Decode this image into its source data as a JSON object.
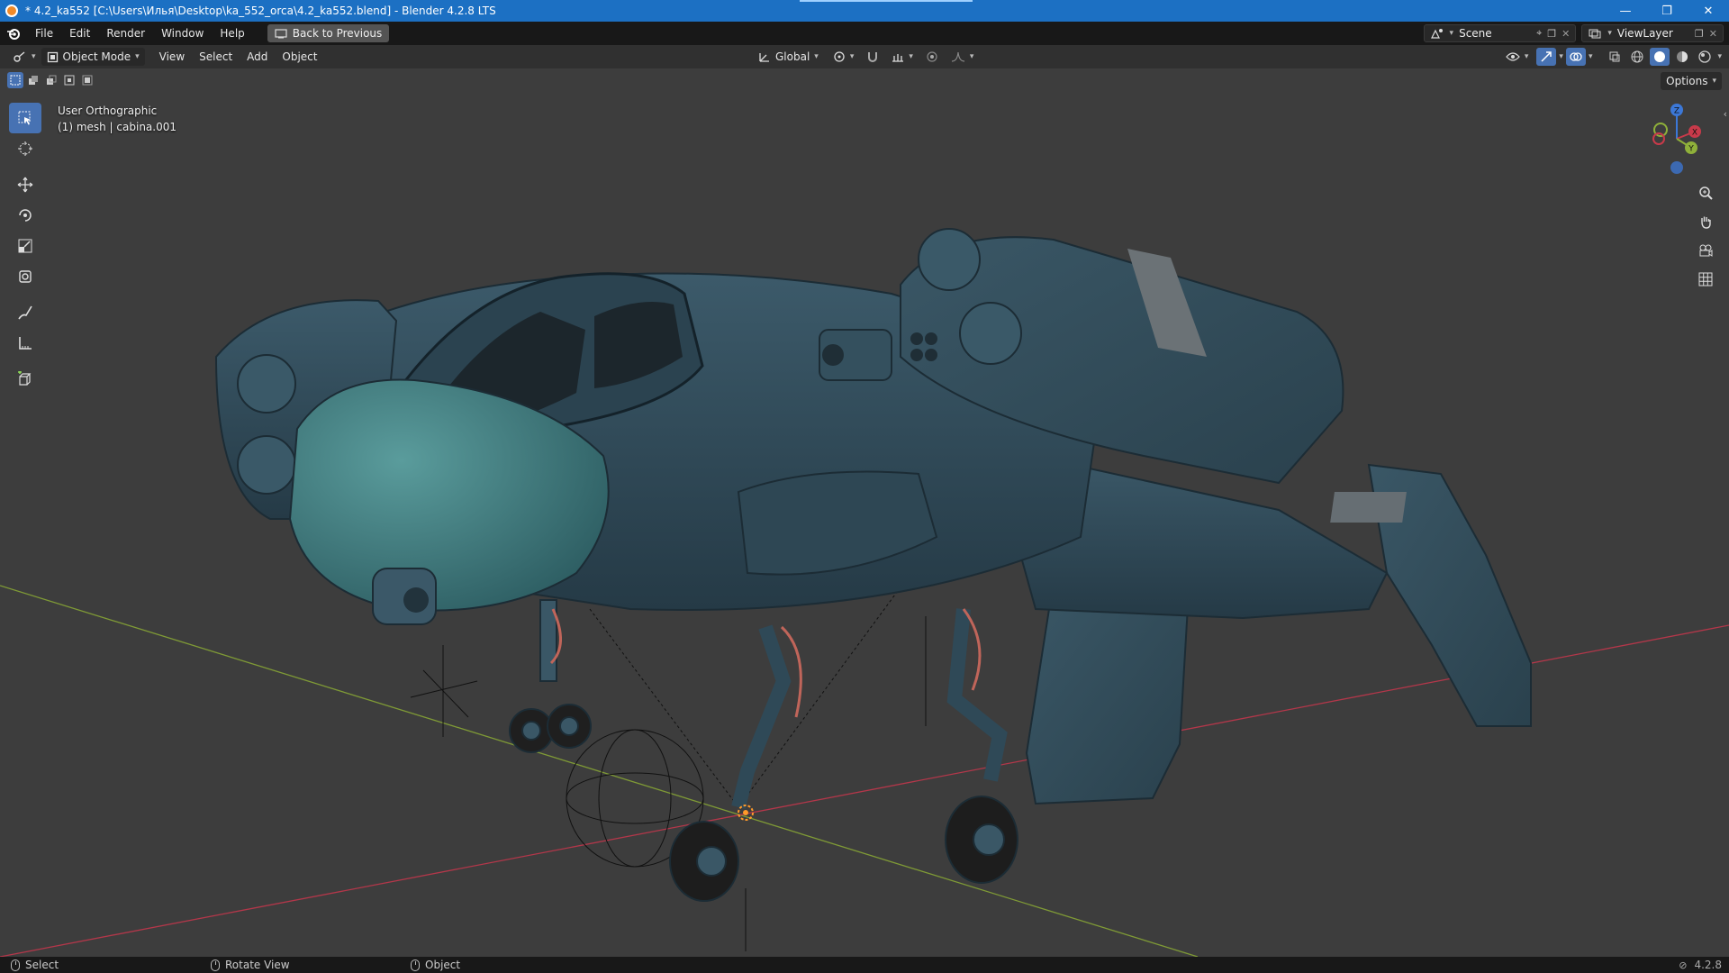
{
  "window": {
    "title": "* 4.2_ka552 [C:\\Users\\Илья\\Desktop\\ka_552_orca\\4.2_ka552.blend] - Blender 4.2.8 LTS",
    "controls": {
      "minimize": "—",
      "restore": "❐",
      "close": "✕"
    }
  },
  "menubar": {
    "items": [
      "File",
      "Edit",
      "Render",
      "Window",
      "Help"
    ],
    "back_button": "Back to Previous",
    "scene": "Scene",
    "view_layer": "ViewLayer"
  },
  "viewheader": {
    "mode": "Object Mode",
    "menus": [
      "View",
      "Select",
      "Add",
      "Object"
    ],
    "transform_orientation": "Global"
  },
  "options_label": "Options",
  "viewport": {
    "view_name": "User Orthographic",
    "object_info": "(1) mesh | cabina.001"
  },
  "gizmo": {
    "z": "Z",
    "x": "X",
    "y": "Y"
  },
  "statusbar": {
    "hints": [
      "Select",
      "Rotate View",
      "Object"
    ],
    "version": "4.2.8"
  },
  "colors": {
    "accent": "#4772b3",
    "titlebar": "#1c70c3",
    "viewport_bg": "#3d3d3d",
    "axis_x": "#c83a4a",
    "axis_y": "#8fb03a",
    "axis_z": "#3c78d8",
    "model_body": "#2f4a58",
    "model_canopy": "#3f7a7c"
  },
  "icons": [
    "blender-logo-icon",
    "select-box-icon",
    "cursor-icon",
    "move-icon",
    "rotate-icon",
    "scale-icon",
    "transform-icon",
    "annotate-icon",
    "measure-icon",
    "add-cube-icon",
    "zoom-icon",
    "hand-icon",
    "camera-icon",
    "grid-icon"
  ]
}
